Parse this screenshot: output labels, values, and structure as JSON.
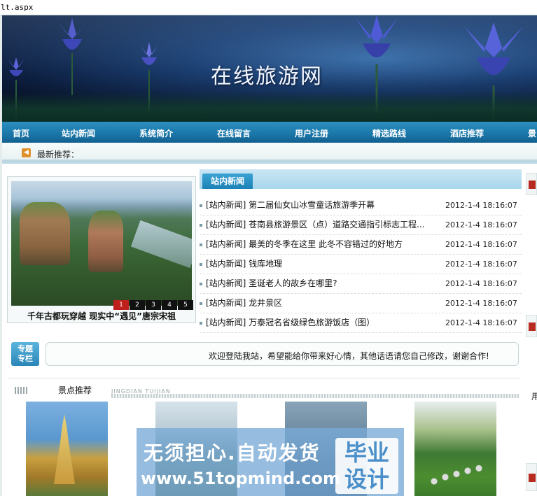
{
  "address_bar": {
    "text": "lt.aspx"
  },
  "banner": {
    "title": "在线旅游网"
  },
  "nav": {
    "items": [
      "首页",
      "站内新闻",
      "系统简介",
      "在线留言",
      "用户注册",
      "精选路线",
      "酒店推荐",
      "景"
    ]
  },
  "latest": {
    "label": "最新推荐："
  },
  "slideshow": {
    "caption": "千年古都玩穿越 现实中“遇见”唐宗宋祖",
    "pages": [
      "1",
      "2",
      "3",
      "4",
      "5"
    ],
    "active_page": "1"
  },
  "news": {
    "tab_label": "站内新闻",
    "items": [
      {
        "title": "[站内新闻] 第二届仙女山冰雪童话旅游季开幕",
        "date": "2012-1-4 18:16:07"
      },
      {
        "title": "[站内新闻] 苍南县旅游景区（点）道路交通指引标志工程...",
        "date": "2012-1-4 18:16:07"
      },
      {
        "title": "[站内新闻] 最美的冬季在这里 此冬不容错过的好地方",
        "date": "2012-1-4 18:16:07"
      },
      {
        "title": "[站内新闻] 钱库地理",
        "date": "2012-1-4 18:16:07"
      },
      {
        "title": "[站内新闻] 圣诞老人的故乡在哪里?",
        "date": "2012-1-4 18:16:07"
      },
      {
        "title": "[站内新闻] 龙井景区",
        "date": "2012-1-4 18:16:07"
      },
      {
        "title": "[站内新闻] 万泰冠名省级绿色旅游饭店（图）",
        "date": "2012-1-4 18:16:07"
      }
    ]
  },
  "special": {
    "badge_line1": "专题",
    "badge_line2": "专栏",
    "welcome_text": "欢迎登陆我站，希望能给你带来好心情，其他话语请您自己修改，谢谢合作!"
  },
  "scenic": {
    "label": "景点推荐",
    "sublabel": "JINGDIAN TUIJIAN"
  },
  "right_edge": {
    "text": "用"
  },
  "watermark": {
    "line1": "无须担心.自动发货",
    "line2": "www.51topmind.com",
    "side_line1": "毕业",
    "side_line2": "设计"
  },
  "colors": {
    "nav_bg": "#1a76a8",
    "tab_bg": "#1d82b6",
    "pager_active": "#c0201c"
  }
}
